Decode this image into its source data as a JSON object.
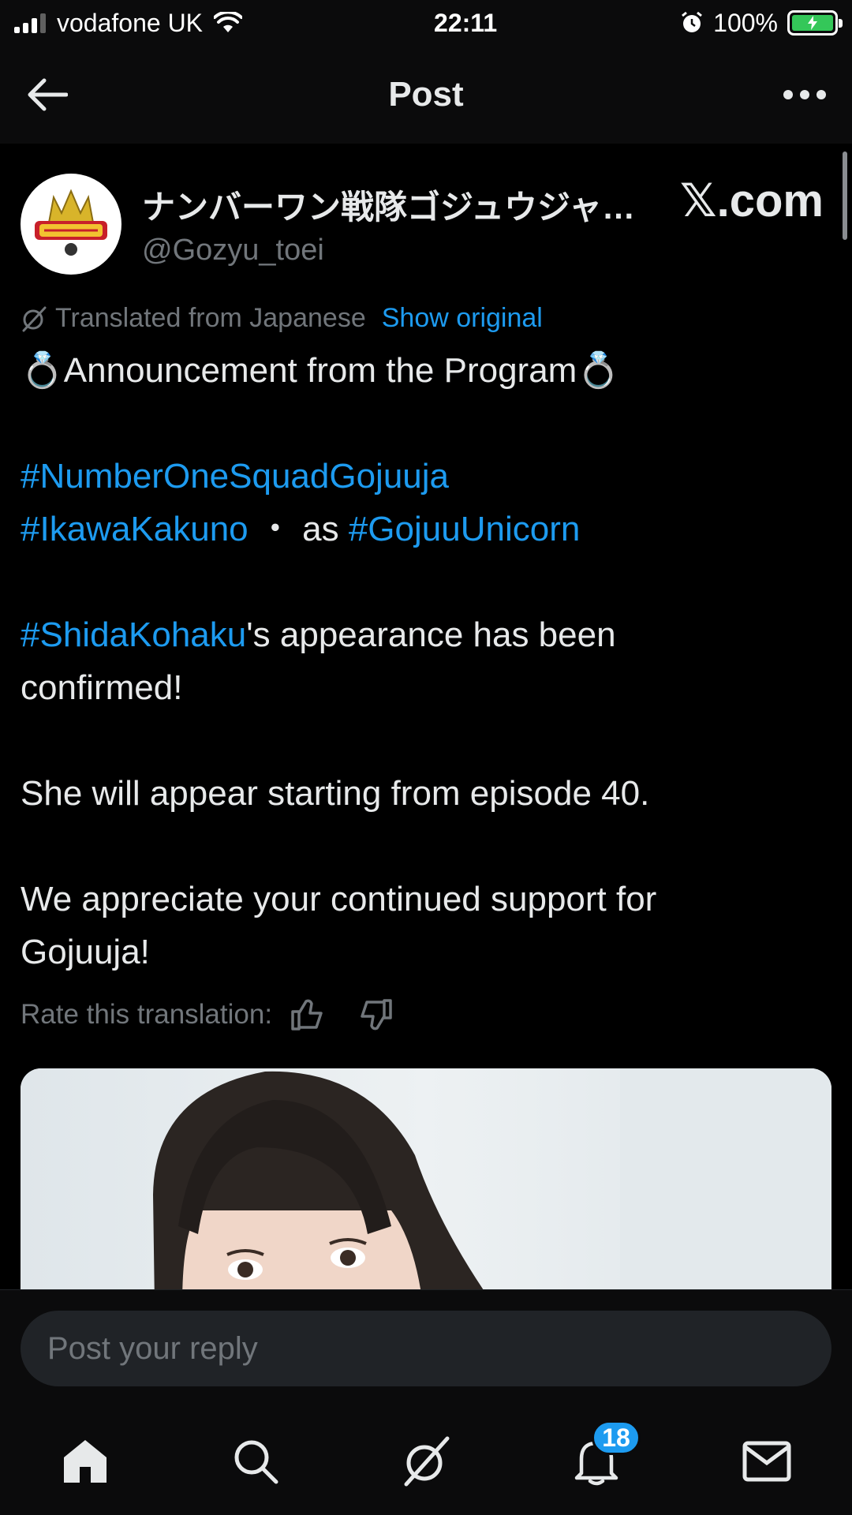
{
  "status_bar": {
    "carrier": "vodafone UK",
    "time": "22:11",
    "battery": "100%"
  },
  "header": {
    "title": "Post"
  },
  "author": {
    "name": "ナンバーワン戦隊ゴジュウジャ…",
    "handle": "@Gozyu_toei",
    "source": "𝕏.com"
  },
  "translation": {
    "label": "Translated from Japanese",
    "show_original": "Show original",
    "rate_label": "Rate this translation:"
  },
  "post": {
    "line1": "💍Announcement from the Program💍",
    "tag1": "#NumberOneSquadGojuuja",
    "tag2": "#IkawaKakuno",
    "sep": "・ as ",
    "tag3": "#GojuuUnicorn",
    "tag4": "#ShidaKohaku",
    "line4a": "'s appearance has been",
    "line4b": "confirmed!",
    "line5": "She will appear starting from episode 40.",
    "line6a": "We appreciate your continued support for",
    "line6b": "Gojuuja!"
  },
  "reply": {
    "placeholder": "Post your reply"
  },
  "nav": {
    "notification_count": "18"
  }
}
